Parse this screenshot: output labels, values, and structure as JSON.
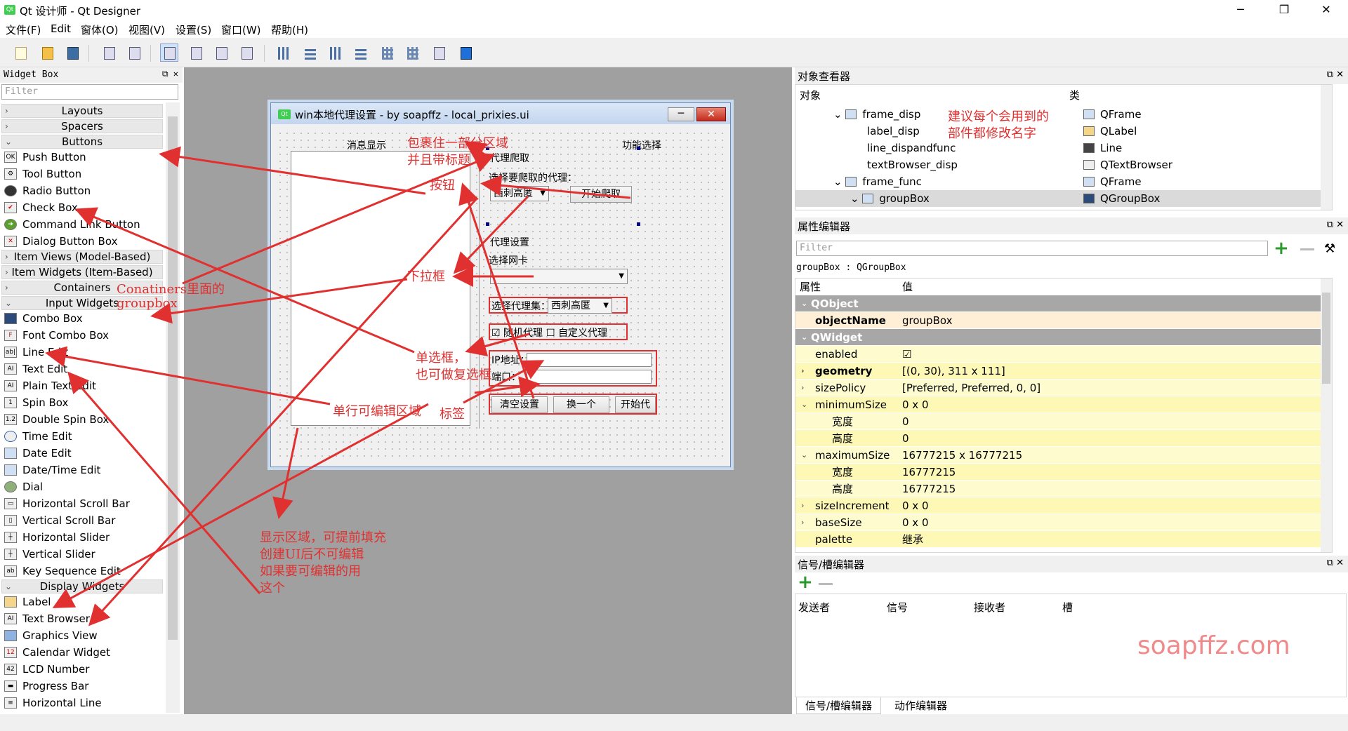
{
  "window": {
    "title": "Qt 设计师 - Qt Designer",
    "app_icon": "Qt",
    "minimize": "─",
    "maximize": "❐",
    "close": "✕"
  },
  "menu": [
    "文件(F)",
    "Edit",
    "窗体(O)",
    "视图(V)",
    "设置(S)",
    "窗口(W)",
    "帮助(H)"
  ],
  "widget_box": {
    "title": "Widget Box",
    "filter_placeholder": "Filter",
    "categories": {
      "layouts": "Layouts",
      "spacers": "Spacers",
      "buttons": "Buttons",
      "item_views": "Item Views (Model-Based)",
      "item_widgets": "Item Widgets (Item-Based)",
      "containers": "Containers",
      "input_widgets": "Input Widgets",
      "display_widgets": "Display Widgets"
    },
    "buttons": [
      "Push Button",
      "Tool Button",
      "Radio Button",
      "Check Box",
      "Command Link Button",
      "Dialog Button Box"
    ],
    "inputs": [
      "Combo Box",
      "Font Combo Box",
      "Line Edit",
      "Text Edit",
      "Plain Text Edit",
      "Spin Box",
      "Double Spin Box",
      "Time Edit",
      "Date Edit",
      "Date/Time Edit",
      "Dial",
      "Horizontal Scroll Bar",
      "Vertical Scroll Bar",
      "Horizontal Slider",
      "Vertical Slider",
      "Key Sequence Edit"
    ],
    "displays": [
      "Label",
      "Text Browser",
      "Graphics View",
      "Calendar Widget",
      "LCD Number",
      "Progress Bar",
      "Horizontal Line"
    ]
  },
  "form": {
    "title": "win本地代理设置 - by soapffz - local_prixies.ui",
    "msg_title": "消息显示",
    "func_title": "功能选择",
    "crawl_group": "代理爬取",
    "choose_proxy": "选择要爬取的代理：",
    "proxy_combo": "西刺高匿",
    "start_crawl": "开始爬取",
    "settings_group": "代理设置",
    "choose_nic": "选择网卡",
    "proxy_set_label": "选择代理集：",
    "proxy_set_combo": "西刺高匿",
    "random_proxy": "随机代理",
    "custom_proxy": "自定义代理",
    "ip_label": "IP地址：",
    "port_label": "端口：",
    "btn_clear": "清空设置",
    "btn_change": "换一个",
    "btn_start": "开始代"
  },
  "object_inspector": {
    "title": "对象查看器",
    "col_object": "对象",
    "col_class": "类",
    "rows": [
      {
        "name": "frame_disp",
        "cls": "QFrame"
      },
      {
        "name": "label_disp",
        "cls": "QLabel"
      },
      {
        "name": "line_dispandfunc",
        "cls": "Line"
      },
      {
        "name": "textBrowser_disp",
        "cls": "QTextBrowser"
      },
      {
        "name": "frame_func",
        "cls": "QFrame"
      },
      {
        "name": "groupBox",
        "cls": "QGroupBox"
      }
    ]
  },
  "property_editor": {
    "title": "属性编辑器",
    "filter_placeholder": "Filter",
    "object_line": "groupBox : QGroupBox",
    "col_prop": "属性",
    "col_value": "值",
    "rows": [
      {
        "k": "QObject",
        "v": ""
      },
      {
        "k": "objectName",
        "v": "groupBox"
      },
      {
        "k": "QWidget",
        "v": ""
      },
      {
        "k": "enabled",
        "v": "☑"
      },
      {
        "k": "geometry",
        "v": "[(0, 30), 311 x 111]"
      },
      {
        "k": "sizePolicy",
        "v": "[Preferred, Preferred, 0, 0]"
      },
      {
        "k": "minimumSize",
        "v": "0 x 0"
      },
      {
        "k": "宽度",
        "v": "0"
      },
      {
        "k": "高度",
        "v": "0"
      },
      {
        "k": "maximumSize",
        "v": "16777215 x 16777215"
      },
      {
        "k": "宽度",
        "v": "16777215"
      },
      {
        "k": "高度",
        "v": "16777215"
      },
      {
        "k": "sizeIncrement",
        "v": "0 x 0"
      },
      {
        "k": "baseSize",
        "v": "0 x 0"
      },
      {
        "k": "palette",
        "v": "继承"
      }
    ]
  },
  "signal_editor": {
    "title": "信号/槽编辑器",
    "cols": [
      "发送者",
      "信号",
      "接收者",
      "槽"
    ]
  },
  "bottom_tabs": [
    "信号/槽编辑器",
    "动作编辑器"
  ],
  "watermark": "soapffz.com",
  "annotations": {
    "contain_area": "包裹住一部分区域",
    "with_title": "并且带标题",
    "button": "按钮",
    "rename_1": "建议每个会用到的",
    "rename_2": "部件都修改名字",
    "containers_a": "Conatiners里面的",
    "containers_b": "groupbox",
    "combo": "下拉框",
    "radio_1": "单选框，",
    "radio_2": "也可做复选框",
    "line_edit": "单行可编辑区域",
    "label": "标签",
    "display_1": "显示区域，可提前填充",
    "display_2": "创建UI后不可编辑",
    "display_3": "如果要可编辑的用",
    "display_4": "这个"
  }
}
